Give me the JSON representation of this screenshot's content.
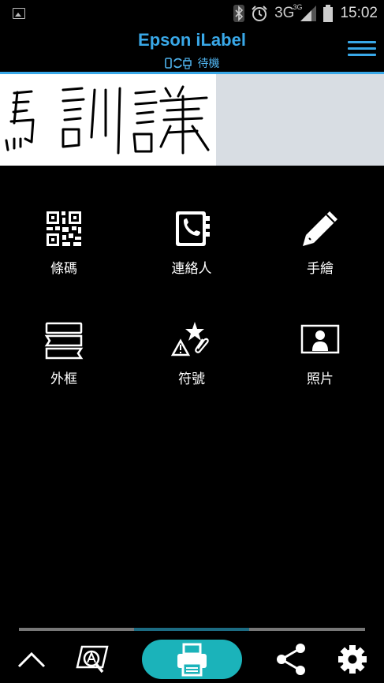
{
  "statusbar": {
    "network": "3G",
    "network_sub": "3G",
    "time": "15:02"
  },
  "header": {
    "title": "Epson iLabel",
    "status": "待機"
  },
  "menu": [
    {
      "label": "條碼",
      "icon": "qr-code-icon"
    },
    {
      "label": "連絡人",
      "icon": "contact-book-icon"
    },
    {
      "label": "手繪",
      "icon": "pencil-icon"
    },
    {
      "label": "外框",
      "icon": "frame-icon"
    },
    {
      "label": "符號",
      "icon": "symbol-icon"
    },
    {
      "label": "照片",
      "icon": "photo-icon"
    }
  ],
  "colors": {
    "accent": "#39a8e8",
    "print": "#1bb3ba",
    "tab_active": "#1c6b82"
  }
}
